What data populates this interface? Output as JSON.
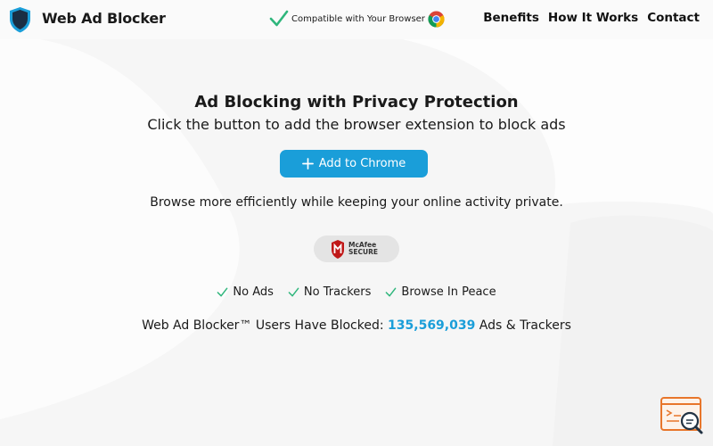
{
  "header": {
    "brand": "Web Ad Blocker",
    "compat_text": "Compatible with Your Browser",
    "nav": [
      "Benefits",
      "How It Works",
      "Contact"
    ]
  },
  "main": {
    "title": "Ad Blocking with Privacy Protection",
    "subtitle": "Click the button to add the browser extension to block ads",
    "button_label": "Add to Chrome",
    "tagline": "Browse more efficiently while keeping your online activity private.",
    "badge_text": "McAfee SECURE",
    "features": [
      "No Ads",
      "No Trackers",
      "Browse In Peace"
    ],
    "stats": {
      "prefix": "Web Ad Blocker™ Users Have Blocked: ",
      "count": "135,569,039",
      "suffix": " Ads & Trackers"
    }
  },
  "colors": {
    "accent": "#1a9ed9",
    "check": "#2fb67c",
    "shield": "#1a2f45",
    "mcafee_red": "#c01818",
    "widget": "#e8762b"
  },
  "icons": [
    "shield-logo-icon",
    "check-icon",
    "chrome-icon",
    "plus-icon",
    "mcafee-logo-icon",
    "search-widget-icon"
  ]
}
